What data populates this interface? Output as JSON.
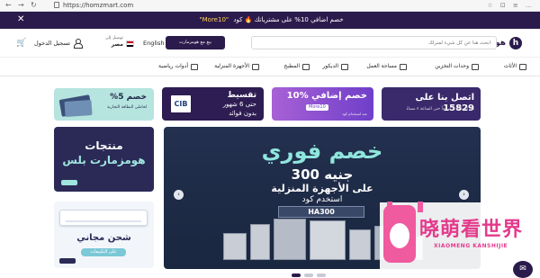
{
  "browser": {
    "back": "←",
    "forward": "→",
    "reload": "↻",
    "url": "https://homzmart.com",
    "icons": "☆ ⊡ ≡ …"
  },
  "promo": {
    "close": "✕",
    "message": "خصم اضافي 10% على مشترياتك 🔥 كود",
    "code": "\"More10\""
  },
  "header": {
    "logo_mark": "h",
    "logo_text": "هومزمارت",
    "search_placeholder": "ابحث هنا عن كل شيء لمنزلك",
    "sell_button": "بيع مع هومزمارت",
    "language": "English",
    "deliver_to_label": "توصيل إلى",
    "deliver_to_value": "مصر",
    "login": "تسجيل الدخول",
    "cart_icon": "🛒"
  },
  "categories": [
    {
      "label": "الأثاث",
      "icon": "sofa-icon"
    },
    {
      "label": "وحدات التخزين",
      "icon": "storage-icon"
    },
    {
      "label": "مساحة العمل",
      "icon": "desk-icon"
    },
    {
      "label": "الديكور",
      "icon": "frame-icon"
    },
    {
      "label": "المطبخ",
      "icon": "kitchen-icon"
    },
    {
      "label": "الأجهزة المنزلية",
      "icon": "appliance-icon"
    },
    {
      "label": "أدوات رياضية",
      "icon": "sports-icon"
    }
  ],
  "banners": {
    "call": {
      "title": "اتصل بنا على 15829",
      "subtitle": "من الساعة ٩ صباحاً حتى الساعة ٧ مساءً"
    },
    "extra": {
      "title": "10% خصم إضافي",
      "chip": "More10",
      "subtitle": "عند استخدام كود"
    },
    "cib": {
      "logo": "CIB",
      "line1": "تقسيط",
      "line2": "حتى 6 شهور",
      "line3": "بدون فوائد"
    },
    "card": {
      "title": "خصم 5%",
      "subtitle": "لحاملي البطاقة التجارية"
    },
    "plus": {
      "line1": "منتجات",
      "line2": "هومزمارت بلس"
    },
    "shipping": {
      "title": "شحن مجاني",
      "pill": "على التكييفات"
    },
    "hero": {
      "h1": "خصم فوري",
      "h2": "300 جنيه",
      "h3": "على الأجهزة المنزلية",
      "h4": "استخدم كود",
      "code": "HA300"
    }
  },
  "carousel": {
    "prev": "‹",
    "next": "›",
    "slides": 3,
    "active": 1
  },
  "chat_icon": "✉",
  "watermark": {
    "big": "晓萌看世界",
    "small": "XIAOMENG KANSHIJIE"
  }
}
